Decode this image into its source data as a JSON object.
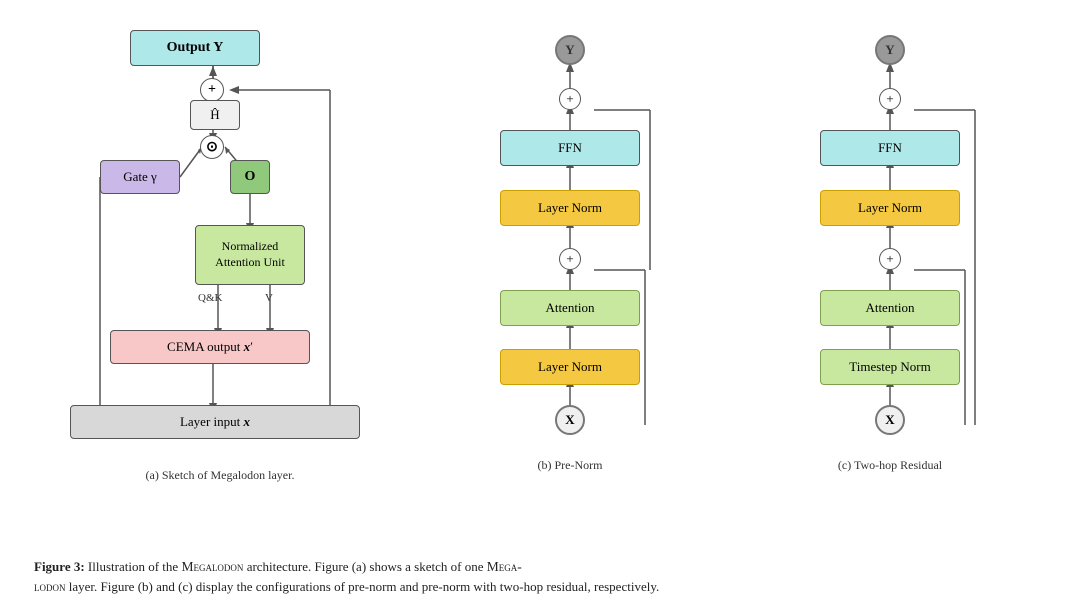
{
  "figure_a": {
    "title": "(a) Sketch of Megalodon layer.",
    "boxes": {
      "output": "Output Y",
      "hhat": "Ĥ",
      "gate": "Gate γ",
      "o": "O",
      "nau": "Normalized\nAttention Unit",
      "cema": "CEMA output x′",
      "layer_input": "Layer input x"
    },
    "labels": {
      "qk": "Q&K",
      "v": "V"
    }
  },
  "figure_b": {
    "title": "(b) Pre-Norm",
    "nodes": {
      "top": "Y",
      "bottom": "X"
    },
    "boxes": {
      "ffn": "FFN",
      "layernorm2": "Layer Norm",
      "attention": "Attention",
      "layernorm1": "Layer Norm"
    }
  },
  "figure_c": {
    "title": "(c) Two-hop Residual",
    "nodes": {
      "top": "Y",
      "bottom": "X"
    },
    "boxes": {
      "ffn": "FFN",
      "layernorm": "Layer Norm",
      "attention": "Attention",
      "timestepnorm": "Timestep Norm"
    }
  },
  "caption": {
    "figure_num": "Figure 3:",
    "text1": " Illustration of the ",
    "megalodon1": "Megalodon",
    "text2": " architecture. Figure (a) shows a sketch of one ",
    "megalodon2": "Mega-",
    "text3": "lodon",
    "text4": " layer. Figure (b) and (c) display the configurations of pre-norm and pre-norm with two-hop residual, respectively."
  }
}
